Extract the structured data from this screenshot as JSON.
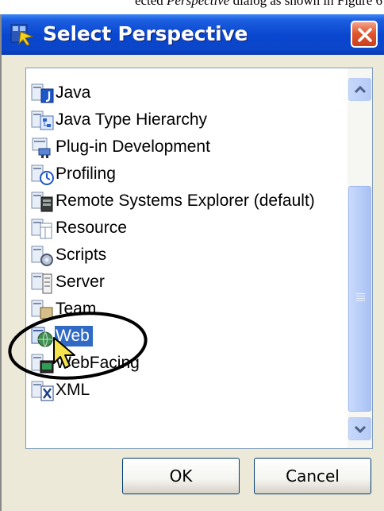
{
  "document_fragment": {
    "before": "ected ",
    "emphasis": "Perspective",
    "after": " dialog as shown in Figure 6"
  },
  "dialog": {
    "title": "Select Perspective",
    "close_icon": "close-icon",
    "perspectives": [
      {
        "label": "Java",
        "icon": "java-perspective-icon"
      },
      {
        "label": "Java Type Hierarchy",
        "icon": "java-type-hierarchy-icon"
      },
      {
        "label": "Plug-in Development",
        "icon": "plugin-development-icon"
      },
      {
        "label": "Profiling",
        "icon": "profiling-icon"
      },
      {
        "label": "Remote Systems Explorer (default)",
        "icon": "remote-systems-icon"
      },
      {
        "label": "Resource",
        "icon": "resource-icon"
      },
      {
        "label": "Scripts",
        "icon": "scripts-icon"
      },
      {
        "label": "Server",
        "icon": "server-icon"
      },
      {
        "label": "Team",
        "icon": "team-icon"
      },
      {
        "label": "Web",
        "icon": "web-icon",
        "selected": true
      },
      {
        "label": "WebFacing",
        "icon": "webfacing-icon"
      },
      {
        "label": "XML",
        "icon": "xml-icon"
      }
    ],
    "ok_label": "OK",
    "cancel_label": "Cancel"
  },
  "colors": {
    "titlebar": "#0a47cf",
    "selection": "#316ac5",
    "close_button": "#e2562e",
    "dialog_face": "#ece9d8",
    "annotation": "#000000"
  }
}
